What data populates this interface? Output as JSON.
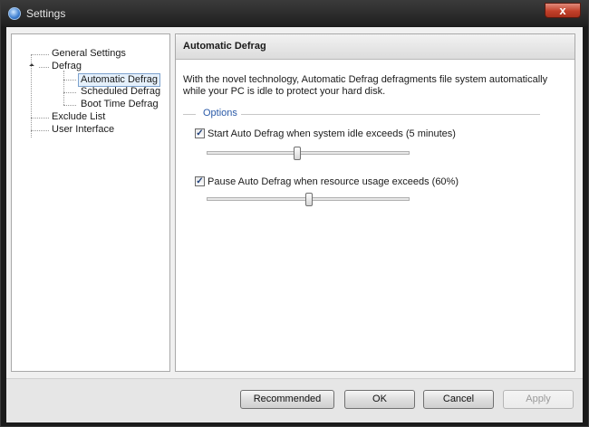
{
  "window": {
    "title": "Settings",
    "close_label": "x"
  },
  "tree": {
    "items": [
      {
        "label": "General Settings"
      },
      {
        "label": "Defrag"
      },
      {
        "label": "Automatic Defrag"
      },
      {
        "label": "Scheduled Defrag"
      },
      {
        "label": "Boot Time Defrag"
      },
      {
        "label": "Exclude List"
      },
      {
        "label": "User Interface"
      }
    ],
    "selected": "Automatic Defrag"
  },
  "panel": {
    "title": "Automatic Defrag",
    "description": "With the novel technology, Automatic Defrag defragments file system automatically while your PC is idle to protect your hard disk.",
    "options_label": "Options",
    "option1": {
      "label": "Start Auto Defrag when system idle exceeds (5 minutes)",
      "checked": true,
      "check_glyph": "✓"
    },
    "option2": {
      "label": "Pause Auto Defrag when resource usage exceeds (60%)",
      "checked": true,
      "check_glyph": "✓"
    }
  },
  "buttons": {
    "recommended": "Recommended",
    "ok": "OK",
    "cancel": "Cancel",
    "apply": "Apply"
  }
}
